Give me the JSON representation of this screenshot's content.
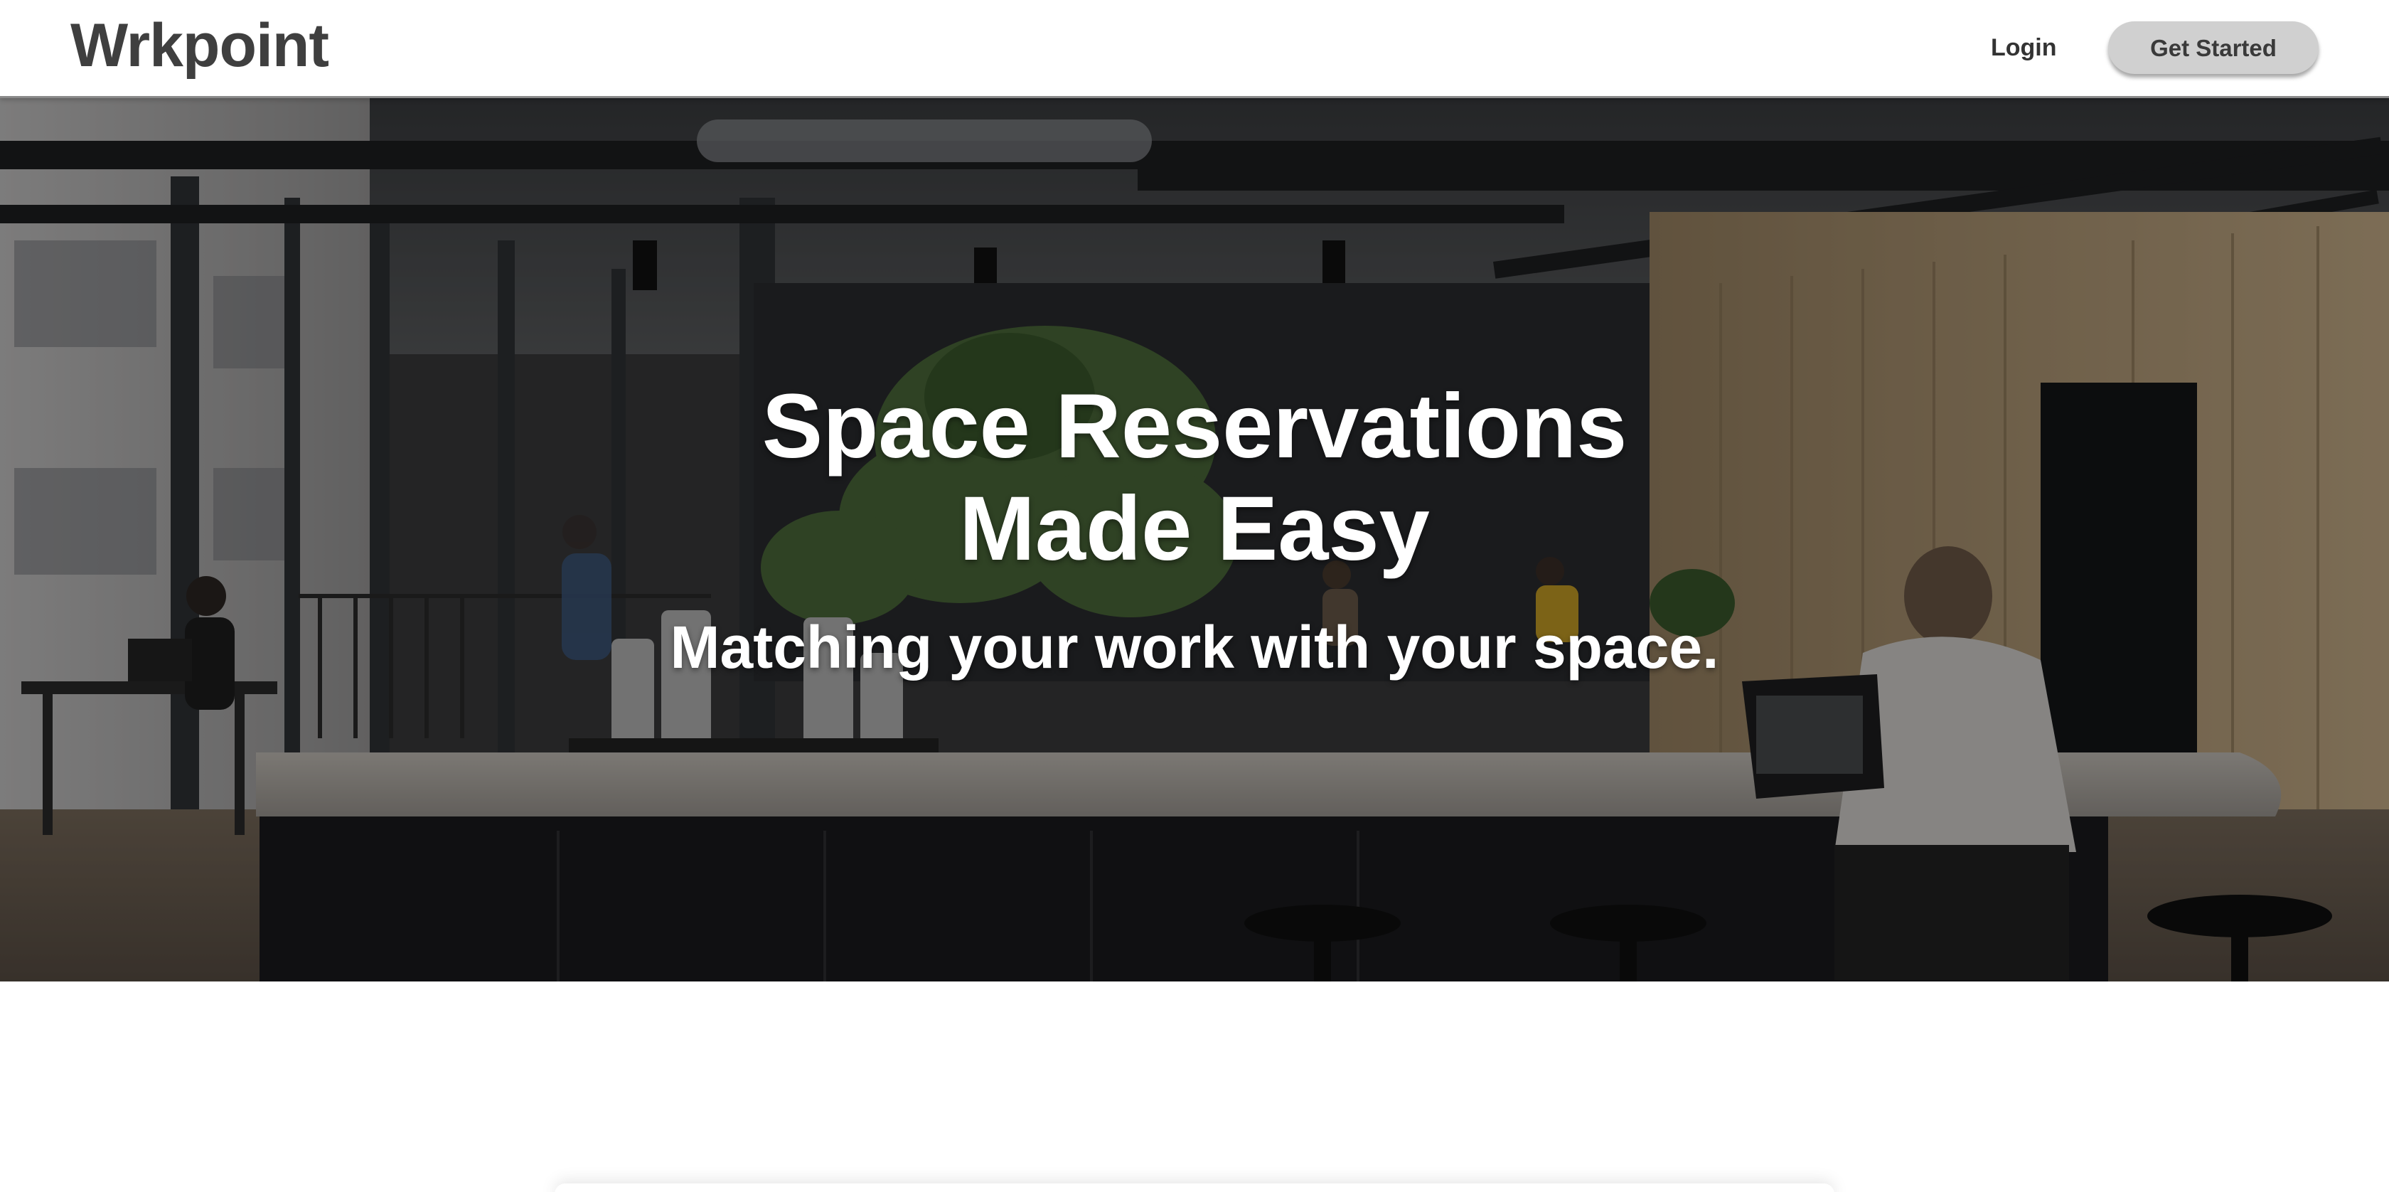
{
  "header": {
    "brand": "Wrkpoint",
    "login_label": "Login",
    "cta_label": "Get Started"
  },
  "hero": {
    "title_line1": "Space Reservations",
    "title_line2": "Made Easy",
    "subtitle": "Matching your work with your space."
  },
  "colors": {
    "brand_text": "#3f3f3f",
    "cta_background": "#d0d0d0",
    "hero_text": "#ffffff"
  }
}
